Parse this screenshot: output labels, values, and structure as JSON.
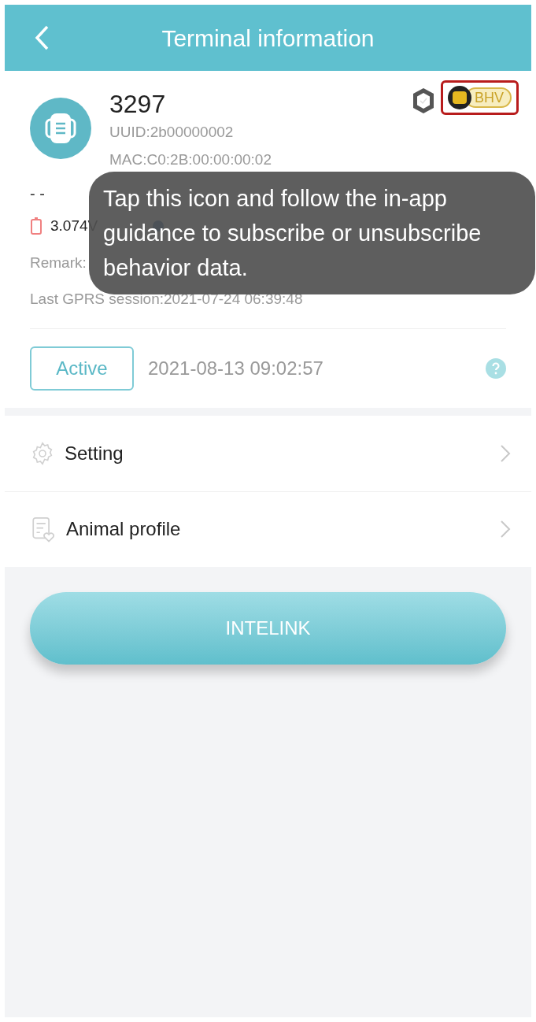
{
  "header": {
    "title": "Terminal information"
  },
  "device": {
    "name": "3297",
    "uuid": "UUID:2b00000002",
    "mac": "MAC:C0:2B:00:00:00:02",
    "placeholder": "- -",
    "battery": "3.074V",
    "remark": "Remark:",
    "last_session": "Last GPRS session:2021-07-24 06:39:48",
    "badge": "BHV"
  },
  "status": {
    "label": "Active",
    "time": "2021-08-13 09:02:57"
  },
  "menu": [
    {
      "kind": "setting",
      "label": "Setting"
    },
    {
      "kind": "profile",
      "label": "Animal profile"
    }
  ],
  "action_button": "INTELINK",
  "tooltip": "Tap this icon and follow the in-app guidance to subscribe or unsubscribe behavior data."
}
